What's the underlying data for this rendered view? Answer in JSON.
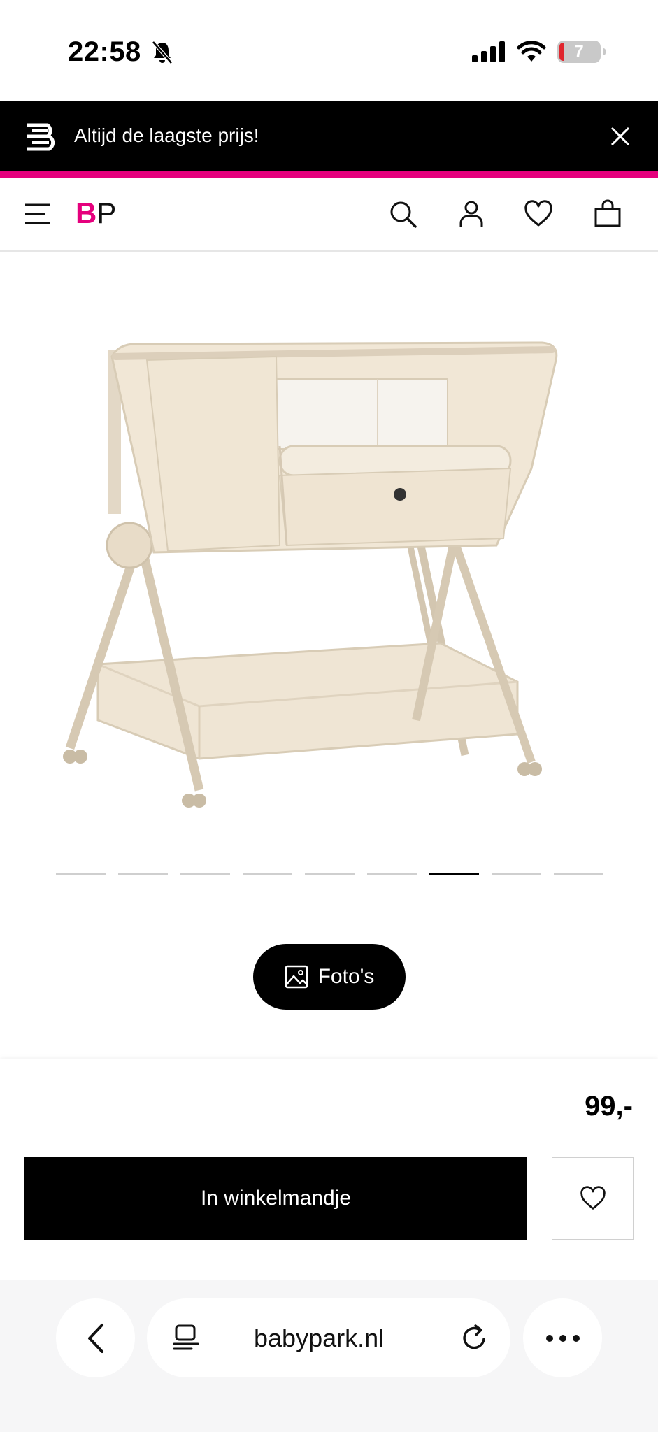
{
  "status": {
    "time": "22:58",
    "battery": "7"
  },
  "promo": {
    "text": "Altijd de laagste prijs!"
  },
  "nav": {
    "logo_b": "B",
    "logo_p": "P"
  },
  "gallery": {
    "dot_count": 9,
    "active_index": 6
  },
  "photos_button": {
    "label": "Foto's"
  },
  "purchase": {
    "price": "99,-",
    "cart_label": "In winkelmandje"
  },
  "browser": {
    "url": "babypark.nl"
  },
  "colors": {
    "brand_pink": "#e5007d",
    "black": "#000000"
  }
}
